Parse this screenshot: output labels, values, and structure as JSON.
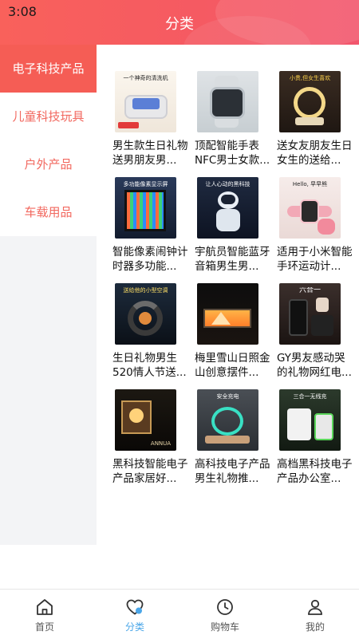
{
  "status": {
    "time": "3:08"
  },
  "header": {
    "title": "分类"
  },
  "sidebar": {
    "items": [
      {
        "label": "电子科技产品",
        "active": true
      },
      {
        "label": "儿童科技玩具",
        "active": false
      },
      {
        "label": "户外产品",
        "active": false
      },
      {
        "label": "车载用品",
        "active": false
      }
    ]
  },
  "products": [
    {
      "name": "男生款生日礼物送男朋友男...",
      "image_text": "一个神奇的清洗机"
    },
    {
      "name": "顶配智能手表NFC男士女款...",
      "image_text": ""
    },
    {
      "name": "送女友朋友生日女生的送给...",
      "image_text": "小贵,但女生喜欢"
    },
    {
      "name": "智能像素闹钟计时器多功能...",
      "image_text": "多功能像素显示屏"
    },
    {
      "name": "宇航员智能蓝牙音箱男生男...",
      "image_text": "让人心动的黑科技"
    },
    {
      "name": "适用于小米智能手环运动计...",
      "image_text": "Hello, 早早熊"
    },
    {
      "name": "生日礼物男生520情人节送...",
      "image_text": "送给他的小型空调"
    },
    {
      "name": "梅里雪山日照金山创意摆件...",
      "image_text": ""
    },
    {
      "name": "GY男友感动哭的礼物网红电...",
      "image_text": "六合一"
    },
    {
      "name": "黑科技智能电子产品家居好...",
      "image_text": "ANNUA"
    },
    {
      "name": "高科技电子产品男生礼物推...",
      "image_text": "安全充电"
    },
    {
      "name": "高档黑科技电子产品办公室...",
      "image_text": "三合一无线充"
    }
  ],
  "tabbar": {
    "items": [
      {
        "label": "首页",
        "icon": "home-icon",
        "active": false
      },
      {
        "label": "分类",
        "icon": "heart-icon",
        "active": true
      },
      {
        "label": "购物车",
        "icon": "clock-icon",
        "active": false
      },
      {
        "label": "我的",
        "icon": "person-icon",
        "active": false
      }
    ]
  },
  "colors": {
    "accent": "#f55d55",
    "tab_active": "#4aa6e8",
    "sidebar_bg": "#f3f4f6"
  }
}
